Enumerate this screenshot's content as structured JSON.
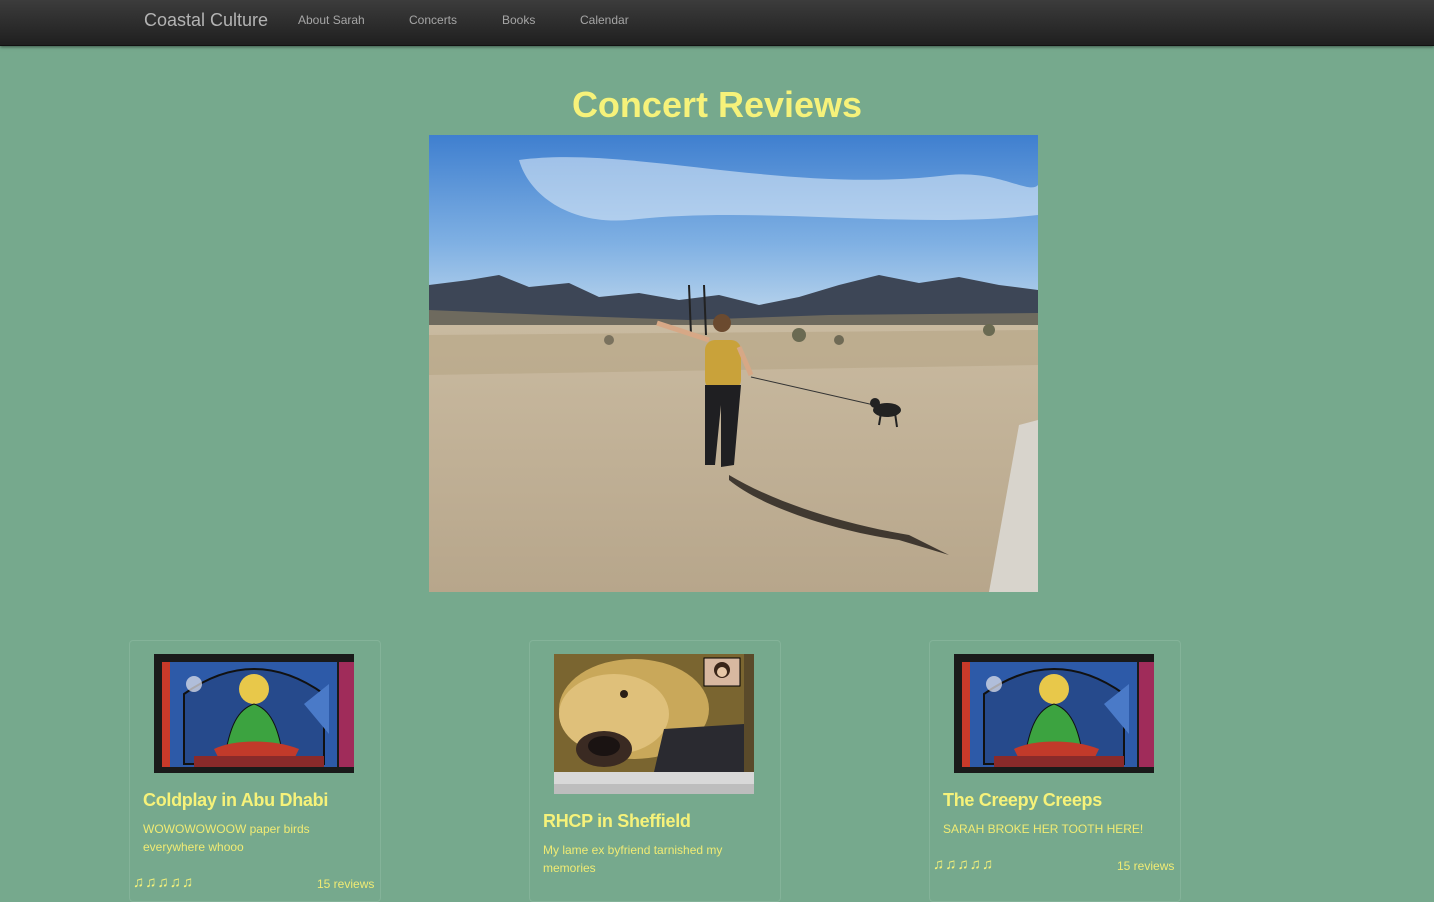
{
  "nav": {
    "brand": "Coastal Culture",
    "links": [
      "About Sarah",
      "Concerts",
      "Books",
      "Calendar"
    ]
  },
  "page": {
    "title": "Concert Reviews"
  },
  "cards": [
    {
      "title": "Coldplay in Abu Dhabi",
      "description": "WOWOWOWOOW paper birds everywhere whooo",
      "rating": "♫♫♫♫♫",
      "reviews": "15 reviews"
    },
    {
      "title": "RHCP in Sheffield",
      "description": "My lame ex byfriend tarnished my memories",
      "rating": "",
      "reviews": ""
    },
    {
      "title": "The Creepy Creeps",
      "description": "SARAH BROKE HER TOOTH HERE!",
      "rating": "♫♫♫♫♫",
      "reviews": "15 reviews"
    }
  ],
  "colors": {
    "background": "#76a98d",
    "accent": "#f6f27a",
    "navbar": "#262626"
  }
}
